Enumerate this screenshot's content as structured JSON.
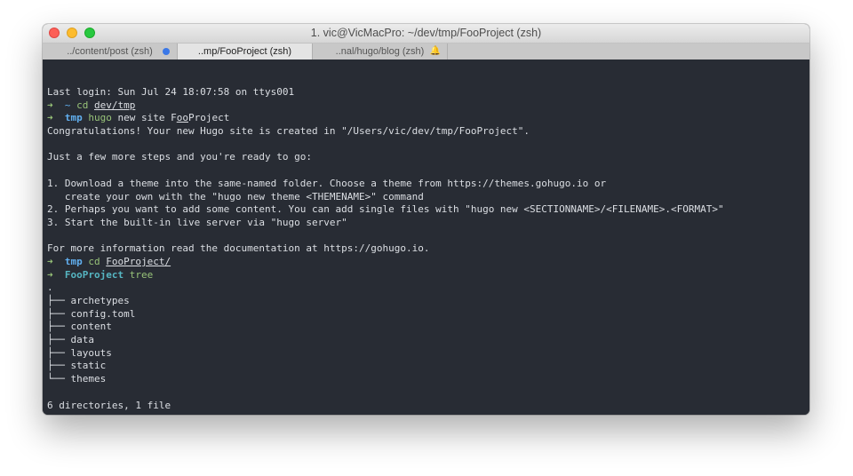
{
  "window": {
    "title": "1. vic@VicMacPro: ~/dev/tmp/FooProject (zsh)"
  },
  "tabs": [
    {
      "label": "../content/post (zsh)"
    },
    {
      "label": "..mp/FooProject (zsh)"
    },
    {
      "label": "..nal/hugo/blog (zsh)"
    }
  ],
  "terminal": {
    "login": "Last login: Sun Jul 24 18:07:58 on ttys001",
    "prompt_arrow": "➜",
    "p1": {
      "cwd": "~",
      "cmd": "cd",
      "arg": "dev/tmp"
    },
    "p2": {
      "cwd": "tmp",
      "cmd_a": "hugo",
      "cmd_b": " new site F",
      "cmd_c": "oo",
      "cmd_d": "Project"
    },
    "congrats": "Congratulations! Your new Hugo site is created in \"/Users/vic/dev/tmp/FooProject\".",
    "steps_intro": "Just a few more steps and you're ready to go:",
    "step1a": "1. Download a theme into the same-named folder. Choose a theme from https://themes.gohugo.io or",
    "step1b": "   create your own with the \"hugo new theme <THEMENAME>\" command",
    "step2": "2. Perhaps you want to add some content. You can add single files with \"hugo new <SECTIONNAME>/<FILENAME>.<FORMAT>\"",
    "step3": "3. Start the built-in live server via \"hugo server\"",
    "more_info": "For more information read the documentation at https://gohugo.io.",
    "p3": {
      "cwd": "tmp",
      "cmd": "cd",
      "arg": "FooProject/"
    },
    "p4": {
      "cwd": "FooProject",
      "cmd": "tree"
    },
    "tree_root": ".",
    "tree": [
      "├── archetypes",
      "├── config.toml",
      "├── content",
      "├── data",
      "├── layouts",
      "├── static",
      "└── themes"
    ],
    "summary": "6 directories, 1 file"
  }
}
